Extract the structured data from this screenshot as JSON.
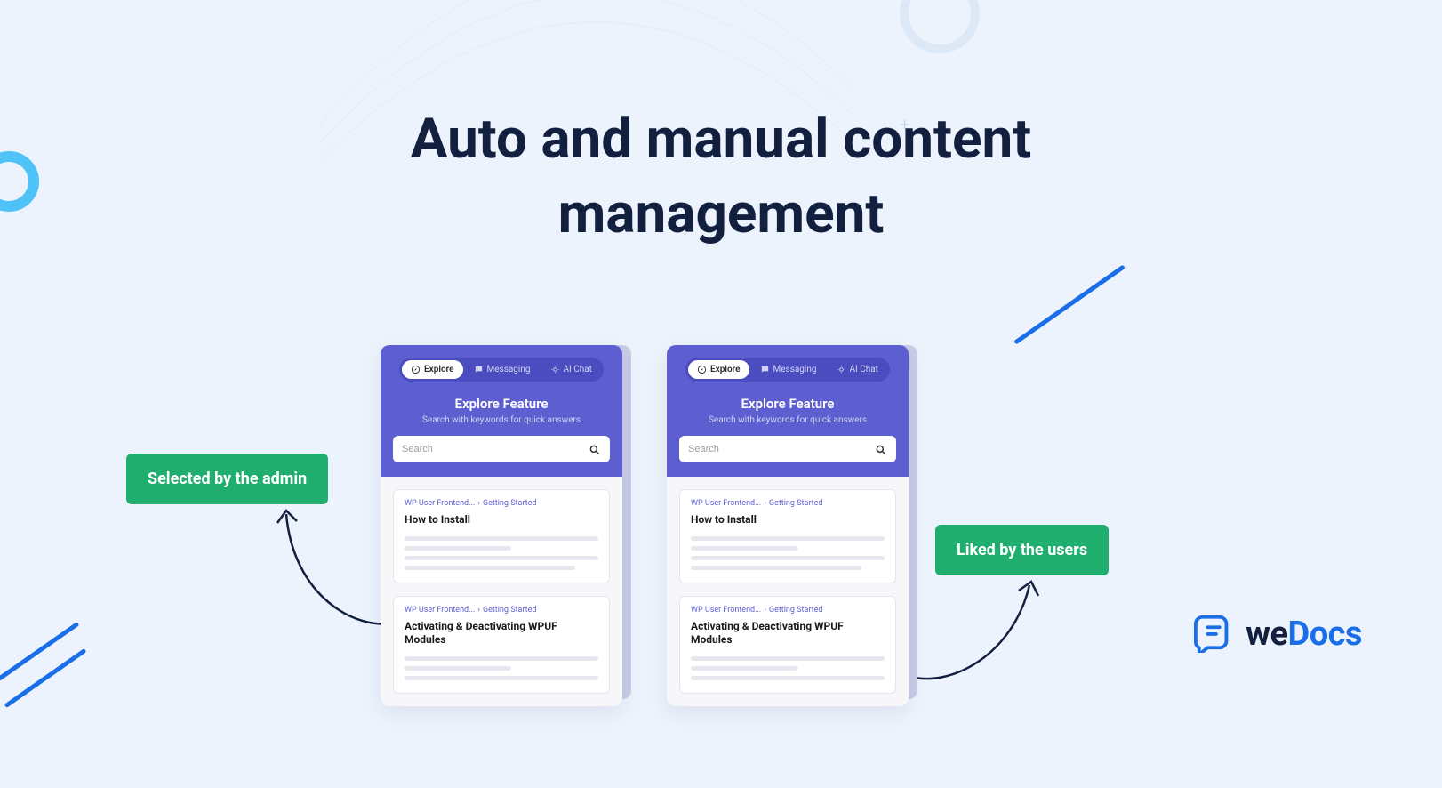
{
  "headline": "Auto and manual content management",
  "badges": {
    "admin": "Selected by the admin",
    "users": "Liked by the users"
  },
  "widget": {
    "tabs": {
      "explore": "Explore",
      "messaging": "Messaging",
      "ai": "AI Chat"
    },
    "title": "Explore Feature",
    "subtitle": "Search with keywords for quick answers",
    "search_placeholder": "Search",
    "results": [
      {
        "crumb_a": "WP User Frontend...",
        "crumb_b": "Getting Started",
        "title": "How to Install"
      },
      {
        "crumb_a": "WP User Frontend...",
        "crumb_b": "Getting Started",
        "title": "Activating & Deactivating WPUF Modules"
      }
    ]
  },
  "brand": {
    "prefix": "we",
    "suffix": "Docs"
  }
}
